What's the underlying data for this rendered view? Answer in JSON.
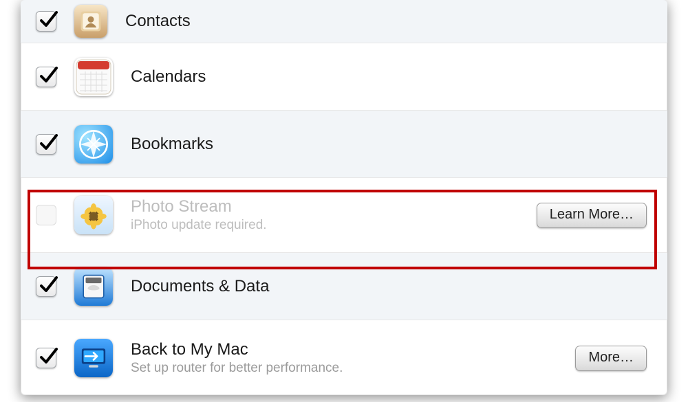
{
  "rows": {
    "contacts": {
      "label": "Contacts"
    },
    "calendars": {
      "label": "Calendars"
    },
    "bookmarks": {
      "label": "Bookmarks"
    },
    "photostream": {
      "label": "Photo Stream",
      "sub": "iPhoto update required.",
      "button": "Learn More…"
    },
    "docs": {
      "label": "Documents & Data"
    },
    "btmm": {
      "label": "Back to My Mac",
      "sub": "Set up router for better performance.",
      "button": "More…"
    }
  }
}
